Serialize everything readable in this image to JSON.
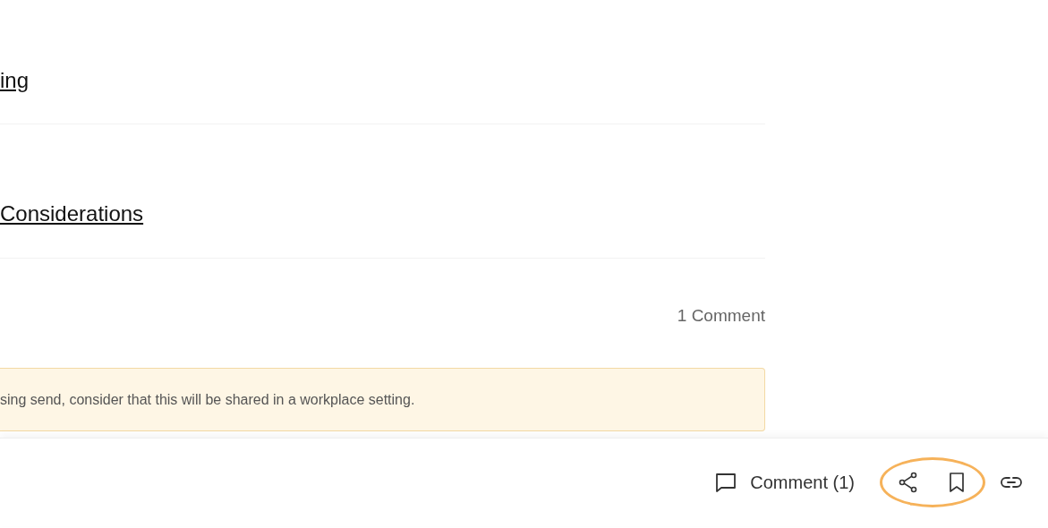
{
  "links": [
    {
      "text": "ing"
    },
    {
      "text": "Considerations"
    }
  ],
  "comment_count": "1 Comment",
  "notice": "sing send, consider that this will be shared in a workplace setting.",
  "action_bar": {
    "comment_button": "Comment (1)",
    "circled_icons": [
      {
        "kind": "share"
      },
      {
        "kind": "bookmark"
      }
    ],
    "icons": [
      {
        "kind": "link"
      }
    ]
  }
}
